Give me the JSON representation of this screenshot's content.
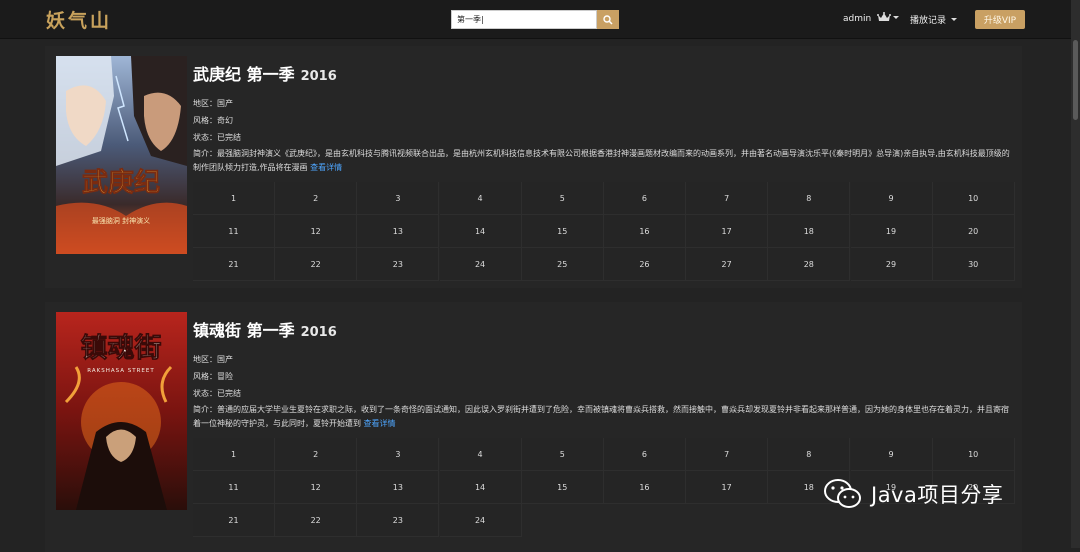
{
  "header": {
    "logo_text": "妖气山",
    "search": {
      "value": "第一季|",
      "placeholder": ""
    },
    "user": "admin",
    "history_label": "播放记录",
    "vip_label": "升级VIP"
  },
  "shows": [
    {
      "title": "武庚纪 第一季",
      "year": "2016",
      "region": "地区：国产",
      "genre": "风格：奇幻",
      "status": "状态：已完结",
      "intro": "简介：最强脑洞封神演义《武庚纪》，是由玄机科技与腾讯视频联合出品，是由杭州玄机科技信息技术有限公司根据香港封神漫画题材改编而来的动画系列，并由著名动画导演沈乐平(《秦时明月》总导演)亲自执导,由玄机科技最顶级的制作团队倾力打造,作品将在漫画",
      "detail_link": "查看详情",
      "poster_title": "武庚纪",
      "poster_subtitle": "最强脑洞 封神演义",
      "episodes": [
        "1",
        "2",
        "3",
        "4",
        "5",
        "6",
        "7",
        "8",
        "9",
        "10",
        "11",
        "12",
        "13",
        "14",
        "15",
        "16",
        "17",
        "18",
        "19",
        "20",
        "21",
        "22",
        "23",
        "24",
        "25",
        "26",
        "27",
        "28",
        "29",
        "30"
      ]
    },
    {
      "title": "镇魂街 第一季",
      "year": "2016",
      "region": "地区：国产",
      "genre": "风格：冒险",
      "status": "状态：已完结",
      "intro": "简介：普通的应届大学毕业生夏铃在求职之际，收到了一条奇怪的面试通知，因此误入罗刹街并遭到了危险，幸而被镇魂将曹焱兵搭救，然而接触中，曹焱兵却发现夏铃并非看起来那样普通，因为她的身体里也存在着灵力，并且寄宿着一位神秘的守护灵，与此同时，夏铃开始遭到",
      "detail_link": "查看详情",
      "poster_title": "镇魂街",
      "poster_subtitle": "RAKSHASA STREET",
      "episodes": [
        "1",
        "2",
        "3",
        "4",
        "5",
        "6",
        "7",
        "8",
        "9",
        "10",
        "11",
        "12",
        "13",
        "14",
        "15",
        "16",
        "17",
        "18",
        "19",
        "20",
        "21",
        "22",
        "23",
        "24"
      ]
    }
  ],
  "watermark": "Java项目分享",
  "colors": {
    "accent": "#c9a063",
    "link": "#4ea6ff",
    "background": "#232323"
  }
}
